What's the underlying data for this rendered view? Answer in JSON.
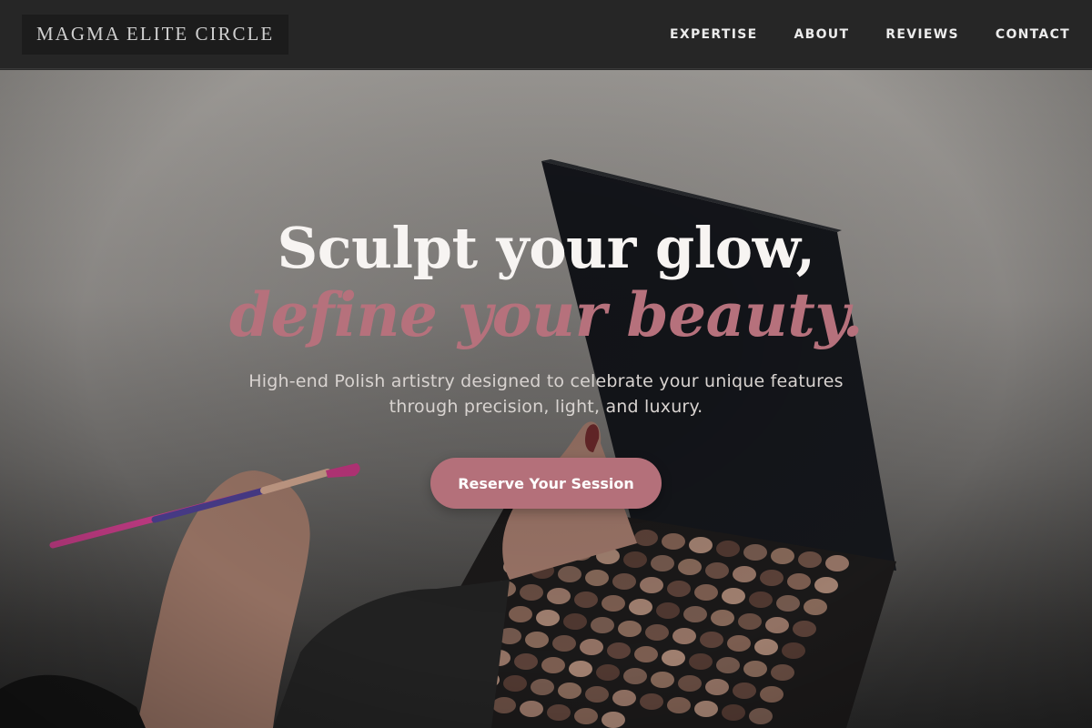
{
  "brand": {
    "name": "MAGMA ELITE CIRCLE"
  },
  "nav": {
    "items": [
      {
        "label": "EXPERTISE"
      },
      {
        "label": "ABOUT"
      },
      {
        "label": "REVIEWS"
      },
      {
        "label": "CONTACT"
      }
    ]
  },
  "hero": {
    "headline_line1": "Sculpt your glow,",
    "headline_line2": "define your beauty.",
    "subtitle": "High-end Polish artistry designed to celebrate your unique features through precision, light, and luxury.",
    "cta_label": "Reserve Your Session",
    "image_subject": "woman holding makeup brush and open eyeshadow palette"
  },
  "colors": {
    "header_bg": "#262626",
    "accent_rose": "#b4707a",
    "headline_white": "#f7f4f2",
    "subtitle_gray": "#d8d3d0"
  }
}
